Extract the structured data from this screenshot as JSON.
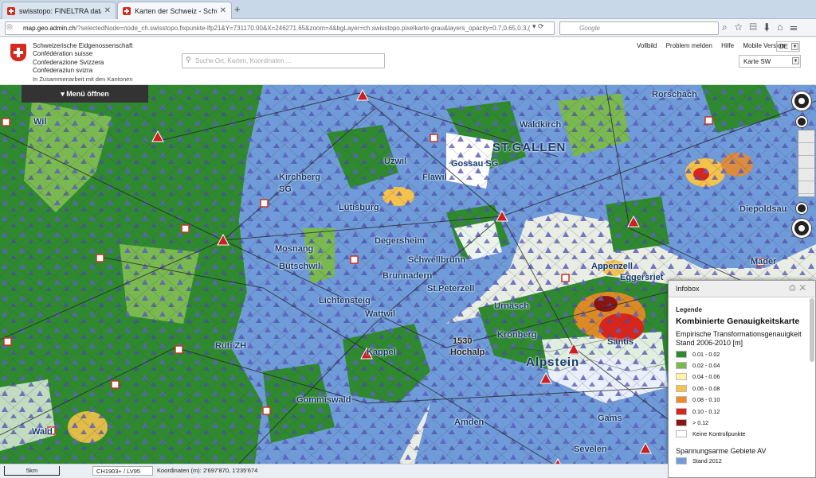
{
  "browser": {
    "tabs": [
      {
        "title": "swisstopo: FINELTRA data ..."
      },
      {
        "title": "Karten der Schweiz - Schw..."
      }
    ],
    "new_tab": "+",
    "url_host": "map.geo.admin.ch",
    "url_path": "/?selectedNode=node_ch.swisstopo.fixpunkte-lfp21&Y=731170.00&X=246271.65&zoom=4&bgLayer=ch.swisstopo.pixelkarte-grau&layers_opacity=0.7,0.65,0.3,(",
    "search_placeholder": "Google",
    "search_engine_badge": "g"
  },
  "site": {
    "federal_names": [
      "Schweizerische Eidgenossenschaft",
      "Confédération suisse",
      "Confederazione Svizzera",
      "Confederaziun svizra"
    ],
    "subtitle": "In Zusammenarbeit mit den Kantonen",
    "search_placeholder": "Suche Ort, Karten, Koordinaten ...",
    "links": [
      "Vollbild",
      "Problem melden",
      "Hilfe",
      "Mobile Version"
    ],
    "language": "DE",
    "background_map": "Karte SW",
    "menu_button": "▾ Menü öffnen"
  },
  "map": {
    "place_labels": [
      {
        "text": "Wil"
      },
      {
        "text": "Kirchberg"
      },
      {
        "text": "SG"
      },
      {
        "text": "Gossau SG"
      },
      {
        "text": "ST.GALLEN"
      },
      {
        "text": "Waldkirch"
      },
      {
        "text": "Rorschach"
      },
      {
        "text": "Uzwil"
      },
      {
        "text": "Flawil"
      },
      {
        "text": "Degersheim"
      },
      {
        "text": "Lütisburg"
      },
      {
        "text": "Mosnang"
      },
      {
        "text": "Bütschwil"
      },
      {
        "text": "Schwellbrunn"
      },
      {
        "text": "Brunnadern"
      },
      {
        "text": "St.Peterzell"
      },
      {
        "text": "Lichtensteig"
      },
      {
        "text": "Wattwil"
      },
      {
        "text": "Urnäsch"
      },
      {
        "text": "Kronberg"
      },
      {
        "text": "Kappel"
      },
      {
        "text": "Hochalp"
      },
      {
        "text": "1530"
      },
      {
        "text": "Alpstein"
      },
      {
        "text": "Säntis"
      },
      {
        "text": "Gams"
      },
      {
        "text": "Gommiswald"
      },
      {
        "text": "Amden"
      },
      {
        "text": "Rüti ZH"
      },
      {
        "text": "Wald"
      },
      {
        "text": "Diepoldsau"
      },
      {
        "text": "Appenzell"
      },
      {
        "text": "Eggersriet"
      },
      {
        "text": "Mäder"
      },
      {
        "text": "Sevelen"
      }
    ],
    "colors": {
      "water": "#6f9bd8",
      "green": "#2f8a2f",
      "lightgreen": "#7bbf52",
      "base": "#eef0ea"
    }
  },
  "infobox": {
    "title": "Infobox",
    "print_icon": "printer-icon",
    "close_icon": "close-icon",
    "legend_heading": "Legende",
    "layer_title": "Kombinierte Genauigkeitskarte",
    "subtitle": "Empirische Transformationsgenauigkeit Stand 2006-2010 [m]",
    "classes": [
      {
        "label": "0.01 - 0.02",
        "color": "#2f8a2f"
      },
      {
        "label": "0.02 - 0.04",
        "color": "#79b94f"
      },
      {
        "label": "0.04 - 0.06",
        "color": "#fff5a0"
      },
      {
        "label": "0.06 - 0.08",
        "color": "#f5c24b"
      },
      {
        "label": "0.08 - 0.10",
        "color": "#ef8a25"
      },
      {
        "label": "0.10 - 0.12",
        "color": "#d8251b"
      },
      {
        "label": "> 0.12",
        "color": "#8c1410"
      },
      {
        "label": "Keine Kontrollpunkte",
        "color": "#ffffff"
      }
    ],
    "second_heading": "Spannungsarme Gebiete AV",
    "second_classes": [
      {
        "label": "Stand 2012",
        "color": "#6f9bd8"
      }
    ]
  },
  "status": {
    "scale": "5km",
    "crs": "CH1903+ / LV95",
    "coordinates_label": "Koordinaten (m):",
    "coordinates_value": "2'697'870, 1'235'674"
  }
}
